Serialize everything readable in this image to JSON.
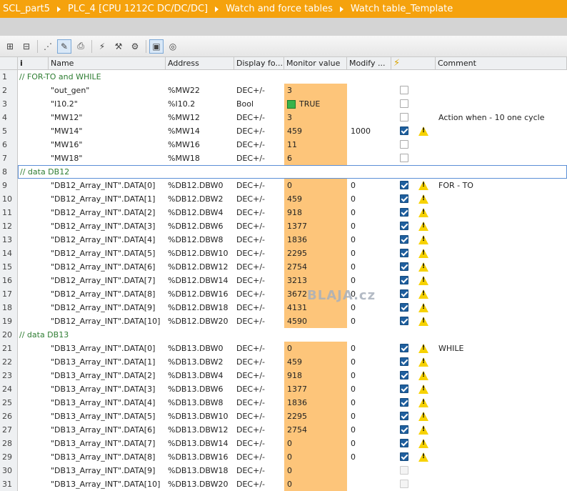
{
  "breadcrumb": [
    "SCL_part5",
    "PLC_4 [CPU 1212C DC/DC/DC]",
    "Watch and force tables",
    "Watch table_Template"
  ],
  "toolbar": {
    "icons": [
      "insert-row-icon",
      "add-row-icon",
      "monitor-all-icon",
      "modify-icon",
      "display-format-icon",
      "force-icon",
      "modify-now-icon",
      "modify-trigger-icon",
      "monitor-once-icon",
      "advanced-settings-icon"
    ]
  },
  "columns": {
    "info": "i",
    "name": "Name",
    "address": "Address",
    "display": "Display fo...",
    "monitor": "Monitor value",
    "modify": "Modify ...",
    "comment": "Comment"
  },
  "colors": {
    "title": "#f5a20d",
    "monitor": "#fdc57a",
    "group_text": "#2e7d32"
  },
  "watermark": "BLAJA.cz",
  "rows": [
    {
      "n": "1",
      "group": "// FOR-TO and WHILE"
    },
    {
      "n": "2",
      "name": "\"out_gen\"",
      "addr": "%MW22",
      "fmt": "DEC+/-",
      "mon": "3",
      "mod": "",
      "cb": "off",
      "warn": false,
      "comment": ""
    },
    {
      "n": "3",
      "name": "\"I10.2\"",
      "addr": "%I10.2",
      "fmt": "Bool",
      "mon": "TRUE",
      "bool": true,
      "mod": "",
      "cb": "off",
      "warn": false,
      "comment": ""
    },
    {
      "n": "4",
      "name": "\"MW12\"",
      "addr": "%MW12",
      "fmt": "DEC+/-",
      "mon": "3",
      "mod": "",
      "cb": "off",
      "warn": false,
      "comment": "Action when - 10 one cycle"
    },
    {
      "n": "5",
      "name": "\"MW14\"",
      "addr": "%MW14",
      "fmt": "DEC+/-",
      "mon": "459",
      "mod": "1000",
      "cb": "on",
      "warn": true,
      "comment": ""
    },
    {
      "n": "6",
      "name": "\"MW16\"",
      "addr": "%MW16",
      "fmt": "DEC+/-",
      "mon": "11",
      "mod": "",
      "cb": "off",
      "warn": false,
      "comment": ""
    },
    {
      "n": "7",
      "name": "\"MW18\"",
      "addr": "%MW18",
      "fmt": "DEC+/-",
      "mon": "6",
      "mod": "",
      "cb": "off",
      "warn": false,
      "comment": ""
    },
    {
      "n": "8",
      "group": "// data DB12"
    },
    {
      "n": "9",
      "name": "\"DB12_Array_INT\".DATA[0]",
      "addr": "%DB12.DBW0",
      "fmt": "DEC+/-",
      "mon": "0",
      "mod": "0",
      "cb": "on",
      "warn": true,
      "comment": "FOR - TO"
    },
    {
      "n": "10",
      "name": "\"DB12_Array_INT\".DATA[1]",
      "addr": "%DB12.DBW2",
      "fmt": "DEC+/-",
      "mon": "459",
      "mod": "0",
      "cb": "on",
      "warn": true,
      "comment": ""
    },
    {
      "n": "11",
      "name": "\"DB12_Array_INT\".DATA[2]",
      "addr": "%DB12.DBW4",
      "fmt": "DEC+/-",
      "mon": "918",
      "mod": "0",
      "cb": "on",
      "warn": true,
      "comment": ""
    },
    {
      "n": "12",
      "name": "\"DB12_Array_INT\".DATA[3]",
      "addr": "%DB12.DBW6",
      "fmt": "DEC+/-",
      "mon": "1377",
      "mod": "0",
      "cb": "on",
      "warn": true,
      "comment": ""
    },
    {
      "n": "13",
      "name": "\"DB12_Array_INT\".DATA[4]",
      "addr": "%DB12.DBW8",
      "fmt": "DEC+/-",
      "mon": "1836",
      "mod": "0",
      "cb": "on",
      "warn": true,
      "comment": ""
    },
    {
      "n": "14",
      "name": "\"DB12_Array_INT\".DATA[5]",
      "addr": "%DB12.DBW10",
      "fmt": "DEC+/-",
      "mon": "2295",
      "mod": "0",
      "cb": "on",
      "warn": true,
      "comment": ""
    },
    {
      "n": "15",
      "name": "\"DB12_Array_INT\".DATA[6]",
      "addr": "%DB12.DBW12",
      "fmt": "DEC+/-",
      "mon": "2754",
      "mod": "0",
      "cb": "on",
      "warn": true,
      "comment": ""
    },
    {
      "n": "16",
      "name": "\"DB12_Array_INT\".DATA[7]",
      "addr": "%DB12.DBW14",
      "fmt": "DEC+/-",
      "mon": "3213",
      "mod": "0",
      "cb": "on",
      "warn": true,
      "comment": ""
    },
    {
      "n": "17",
      "name": "\"DB12_Array_INT\".DATA[8]",
      "addr": "%DB12.DBW16",
      "fmt": "DEC+/-",
      "mon": "3672",
      "mod": "0",
      "cb": "on",
      "warn": true,
      "comment": ""
    },
    {
      "n": "18",
      "name": "\"DB12_Array_INT\".DATA[9]",
      "addr": "%DB12.DBW18",
      "fmt": "DEC+/-",
      "mon": "4131",
      "mod": "0",
      "cb": "on",
      "warn": true,
      "comment": ""
    },
    {
      "n": "19",
      "name": "\"DB12_Array_INT\".DATA[10]",
      "addr": "%DB12.DBW20",
      "fmt": "DEC+/-",
      "mon": "4590",
      "mod": "0",
      "cb": "on",
      "warn": true,
      "comment": ""
    },
    {
      "n": "20",
      "group": "// data DB13"
    },
    {
      "n": "21",
      "name": "\"DB13_Array_INT\".DATA[0]",
      "addr": "%DB13.DBW0",
      "fmt": "DEC+/-",
      "mon": "0",
      "mod": "0",
      "cb": "on",
      "warn": true,
      "comment": "WHILE"
    },
    {
      "n": "22",
      "name": "\"DB13_Array_INT\".DATA[1]",
      "addr": "%DB13.DBW2",
      "fmt": "DEC+/-",
      "mon": "459",
      "mod": "0",
      "cb": "on",
      "warn": true,
      "comment": ""
    },
    {
      "n": "23",
      "name": "\"DB13_Array_INT\".DATA[2]",
      "addr": "%DB13.DBW4",
      "fmt": "DEC+/-",
      "mon": "918",
      "mod": "0",
      "cb": "on",
      "warn": true,
      "comment": ""
    },
    {
      "n": "24",
      "name": "\"DB13_Array_INT\".DATA[3]",
      "addr": "%DB13.DBW6",
      "fmt": "DEC+/-",
      "mon": "1377",
      "mod": "0",
      "cb": "on",
      "warn": true,
      "comment": ""
    },
    {
      "n": "25",
      "name": "\"DB13_Array_INT\".DATA[4]",
      "addr": "%DB13.DBW8",
      "fmt": "DEC+/-",
      "mon": "1836",
      "mod": "0",
      "cb": "on",
      "warn": true,
      "comment": ""
    },
    {
      "n": "26",
      "name": "\"DB13_Array_INT\".DATA[5]",
      "addr": "%DB13.DBW10",
      "fmt": "DEC+/-",
      "mon": "2295",
      "mod": "0",
      "cb": "on",
      "warn": true,
      "comment": ""
    },
    {
      "n": "27",
      "name": "\"DB13_Array_INT\".DATA[6]",
      "addr": "%DB13.DBW12",
      "fmt": "DEC+/-",
      "mon": "2754",
      "mod": "0",
      "cb": "on",
      "warn": true,
      "comment": ""
    },
    {
      "n": "28",
      "name": "\"DB13_Array_INT\".DATA[7]",
      "addr": "%DB13.DBW14",
      "fmt": "DEC+/-",
      "mon": "0",
      "mod": "0",
      "cb": "on",
      "warn": true,
      "comment": ""
    },
    {
      "n": "29",
      "name": "\"DB13_Array_INT\".DATA[8]",
      "addr": "%DB13.DBW16",
      "fmt": "DEC+/-",
      "mon": "0",
      "mod": "0",
      "cb": "on",
      "warn": true,
      "comment": ""
    },
    {
      "n": "30",
      "name": "\"DB13_Array_INT\".DATA[9]",
      "addr": "%DB13.DBW18",
      "fmt": "DEC+/-",
      "mon": "0",
      "mod": "",
      "cb": "dis",
      "warn": false,
      "comment": ""
    },
    {
      "n": "31",
      "name": "\"DB13_Array_INT\".DATA[10]",
      "addr": "%DB13.DBW20",
      "fmt": "DEC+/-",
      "mon": "0",
      "mod": "",
      "cb": "dis",
      "warn": false,
      "comment": ""
    }
  ]
}
